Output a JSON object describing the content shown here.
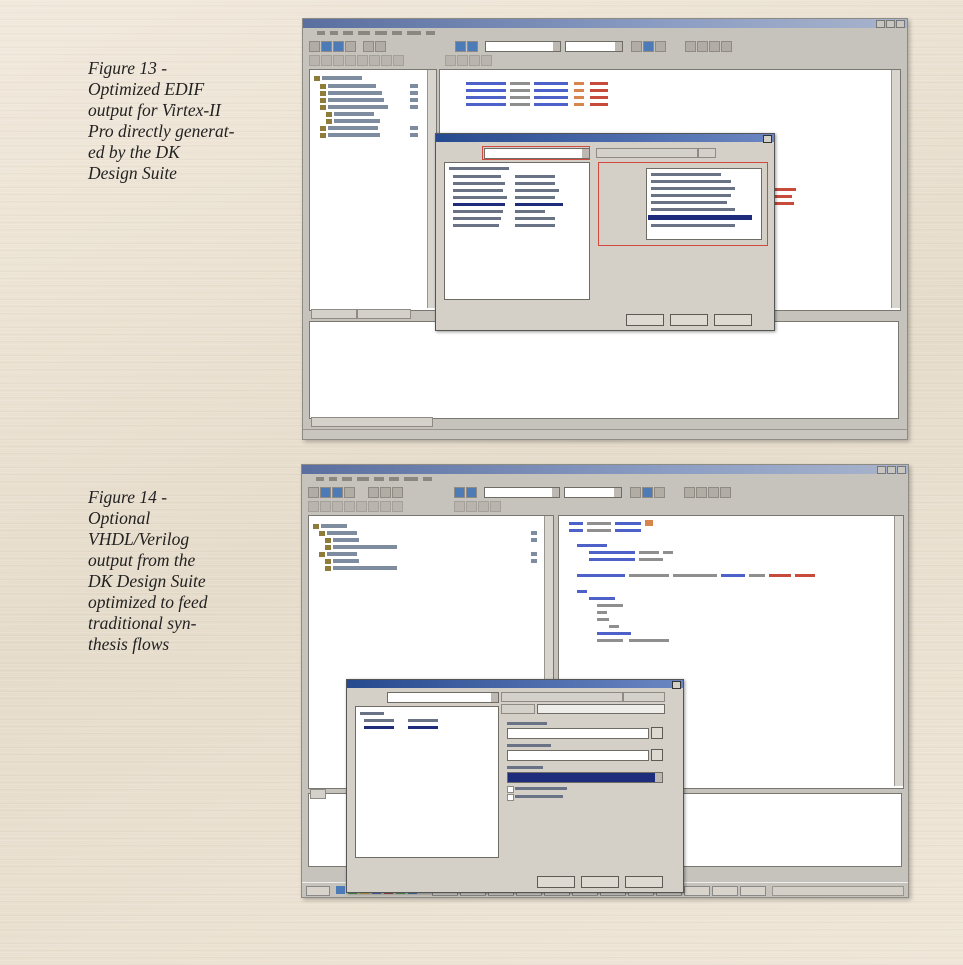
{
  "figure13": {
    "caption_lines": [
      "Figure 13 -",
      "Optimized EDIF",
      "output for Virtex-II",
      "Pro directly generat-",
      "ed by the DK",
      "Design Suite"
    ]
  },
  "figure14": {
    "caption_lines": [
      "Figure 14 -",
      "Optional",
      "VHDL/Verilog",
      "output from the",
      "DK Design Suite",
      "optimized to feed",
      "traditional syn-",
      "thesis flows"
    ]
  },
  "colors": {
    "page_background": "#ece3d4",
    "window_titlebar": "#5a6fa0",
    "dialog_titlebar": "#264a8f",
    "highlight_box": "#d24a3f",
    "selection": "#1d2d7c"
  },
  "icons": [
    "window-control-icon",
    "toolbar-icon",
    "tree-node-icon",
    "close-icon",
    "dropdown-arrow-icon"
  ]
}
